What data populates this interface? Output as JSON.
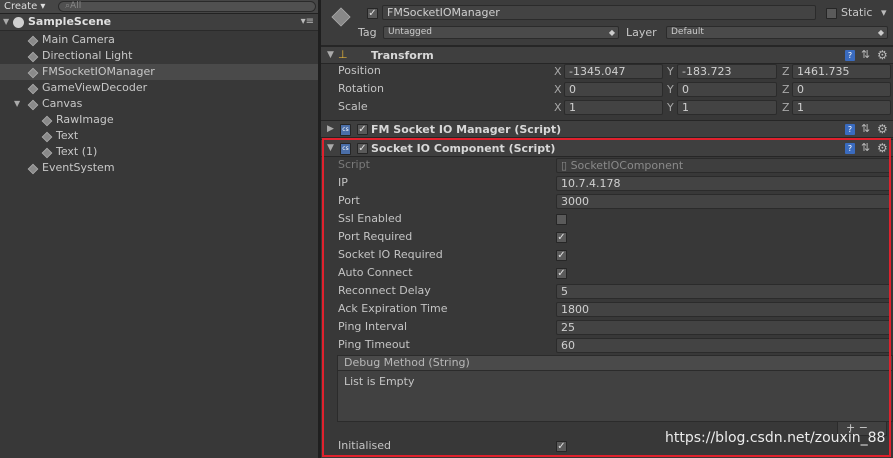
{
  "hierarchy": {
    "create_label": "Create",
    "search_placeholder": "All",
    "scene_name": "SampleScene",
    "items": [
      {
        "label": "Main Camera"
      },
      {
        "label": "Directional Light"
      },
      {
        "label": "FMSocketIOManager"
      },
      {
        "label": "GameViewDecoder"
      },
      {
        "label": "Canvas"
      },
      {
        "label": "RawImage"
      },
      {
        "label": "Text"
      },
      {
        "label": "Text (1)"
      },
      {
        "label": "EventSystem"
      }
    ]
  },
  "inspector": {
    "object_name": "FMSocketIOManager",
    "static_label": "Static",
    "tag_label": "Tag",
    "tag_value": "Untagged",
    "layer_label": "Layer",
    "layer_value": "Default",
    "transform": {
      "title": "Transform",
      "position_label": "Position",
      "rotation_label": "Rotation",
      "scale_label": "Scale",
      "axis_x": "X",
      "axis_y": "Y",
      "axis_z": "Z",
      "position": [
        "-1345.047",
        "-183.723",
        "1461.735"
      ],
      "rotation": [
        "0",
        "0",
        "0"
      ],
      "scale": [
        "1",
        "1",
        "1"
      ]
    },
    "fm_manager": {
      "title": "FM Socket IO Manager (Script)"
    },
    "socket_component": {
      "title": "Socket IO Component (Script)",
      "script_label": "Script",
      "script_value": "SocketIOComponent",
      "ip_label": "IP",
      "ip_value": "10.7.4.178",
      "port_label": "Port",
      "port_value": "3000",
      "ssl_label": "Ssl Enabled",
      "ssl_checked": false,
      "port_required_label": "Port Required",
      "port_required_checked": true,
      "socketio_required_label": "Socket IO Required",
      "socketio_required_checked": true,
      "auto_connect_label": "Auto Connect",
      "auto_connect_checked": true,
      "reconnect_delay_label": "Reconnect Delay",
      "reconnect_delay_value": "5",
      "ack_label": "Ack Expiration Time",
      "ack_value": "1800",
      "ping_interval_label": "Ping Interval",
      "ping_interval_value": "25",
      "ping_timeout_label": "Ping Timeout",
      "ping_timeout_value": "60",
      "debug_method_label": "Debug Method (String)",
      "list_empty_label": "List is Empty",
      "plus_minus": "+ −",
      "initialised_label": "Initialised",
      "initialised_checked": true
    }
  },
  "watermark": "https://blog.csdn.net/zouxin_88",
  "colors": {
    "highlight": "#e0212d",
    "panel": "#383838"
  }
}
